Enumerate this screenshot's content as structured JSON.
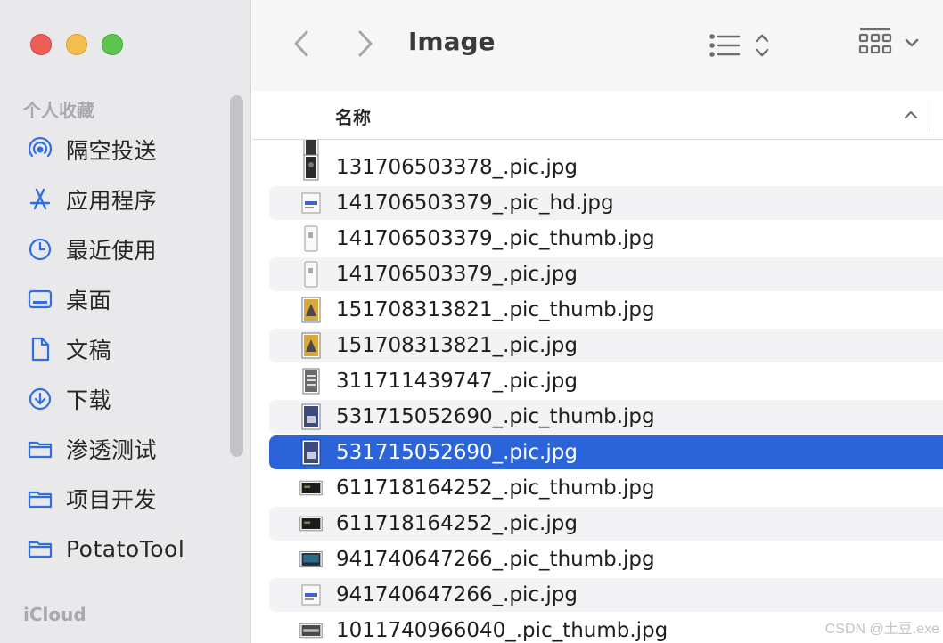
{
  "sidebar": {
    "section_favorites": "个人收藏",
    "section_icloud": "iCloud",
    "items": [
      {
        "label": "隔空投送",
        "icon": "airdrop-icon"
      },
      {
        "label": "应用程序",
        "icon": "applications-icon"
      },
      {
        "label": "最近使用",
        "icon": "clock-icon"
      },
      {
        "label": "桌面",
        "icon": "desktop-icon"
      },
      {
        "label": "文稿",
        "icon": "document-icon"
      },
      {
        "label": "下载",
        "icon": "download-icon"
      },
      {
        "label": "渗透测试",
        "icon": "folder-icon"
      },
      {
        "label": "项目开发",
        "icon": "folder-icon"
      },
      {
        "label": "PotatoTool",
        "icon": "folder-icon"
      }
    ]
  },
  "toolbar": {
    "title": "Image",
    "back_icon": "chevron-left-icon",
    "forward_icon": "chevron-right-icon",
    "list_view_icon": "list-view-icon",
    "group_icon": "grid-group-icon"
  },
  "column_header": {
    "name_label": "名称",
    "sort_icon": "chevron-up-icon"
  },
  "files": [
    {
      "name": "131706503378_.pic.jpg",
      "thumb": "dark-portrait"
    },
    {
      "name": "141706503379_.pic_hd.jpg",
      "thumb": "doc-screenshot"
    },
    {
      "name": "141706503379_.pic_thumb.jpg",
      "thumb": "white-portrait"
    },
    {
      "name": "141706503379_.pic.jpg",
      "thumb": "white-portrait"
    },
    {
      "name": "151708313821_.pic_thumb.jpg",
      "thumb": "yellow-portrait"
    },
    {
      "name": "151708313821_.pic.jpg",
      "thumb": "yellow-portrait"
    },
    {
      "name": "311711439747_.pic.jpg",
      "thumb": "gray-portrait"
    },
    {
      "name": "531715052690_.pic_thumb.jpg",
      "thumb": "blue-portrait"
    },
    {
      "name": "531715052690_.pic.jpg",
      "thumb": "blue-portrait",
      "selected": true
    },
    {
      "name": "611718164252_.pic_thumb.jpg",
      "thumb": "dark-landscape"
    },
    {
      "name": "611718164252_.pic.jpg",
      "thumb": "dark-landscape"
    },
    {
      "name": "941740647266_.pic_thumb.jpg",
      "thumb": "screen-landscape"
    },
    {
      "name": "941740647266_.pic.jpg",
      "thumb": "doc-screenshot"
    },
    {
      "name": "1011740966040_.pic_thumb.jpg",
      "thumb": "gray-landscape"
    }
  ],
  "watermark": "CSDN @土豆.exe",
  "colors": {
    "selection": "#2b63d9",
    "accent_icon": "#2f6fe0",
    "sidebar_bg": "#e9e8ea"
  }
}
